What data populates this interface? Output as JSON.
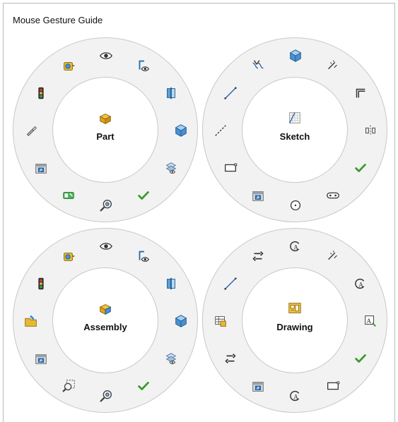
{
  "window": {
    "title": "Mouse Gesture Guide"
  },
  "wheels": [
    {
      "label": "Part",
      "center_icon": "part-icon",
      "slots": [
        "view-normal-to-icon",
        "section-view-icon",
        "isometric-view-icon",
        "hide-show-planes-icon",
        "checkmark-icon",
        "zoom-to-selection-icon",
        "measure-icon",
        "view-selector-icon",
        "flashlight-icon",
        "traffic-light-icon",
        "measure-tape-icon",
        "hide-show-icon"
      ]
    },
    {
      "label": "Sketch",
      "center_icon": "sketch-grid-icon",
      "slots": [
        "smart-dimension-icon",
        "offset-entities-icon",
        "mirror-entities-icon",
        "checkmark-icon",
        "slot-icon",
        "circle-icon",
        "view-selector-icon",
        "rectangle-icon",
        "centerline-icon",
        "line-icon",
        "trim-entities-icon",
        "isometric-view-icon"
      ]
    },
    {
      "label": "Assembly",
      "center_icon": "assembly-icon",
      "slots": [
        "view-normal-to-icon",
        "section-view-icon",
        "isometric-view-icon",
        "hide-show-planes-icon",
        "checkmark-icon",
        "zoom-to-selection-icon",
        "zoom-area-icon",
        "view-selector-icon",
        "open-component-icon",
        "traffic-light-icon",
        "measure-tape-icon",
        "hide-show-icon"
      ]
    },
    {
      "label": "Drawing",
      "center_icon": "drawing-icon",
      "slots": [
        "smart-dimension-icon",
        "note-icon",
        "auto-dimension-icon",
        "checkmark-icon",
        "rectangle-icon",
        "rotate-view-icon",
        "view-selector-icon",
        "flip-arrows-icon",
        "table-icon",
        "line-icon",
        "flip-arrows-icon",
        "rotate-view-icon"
      ]
    }
  ]
}
